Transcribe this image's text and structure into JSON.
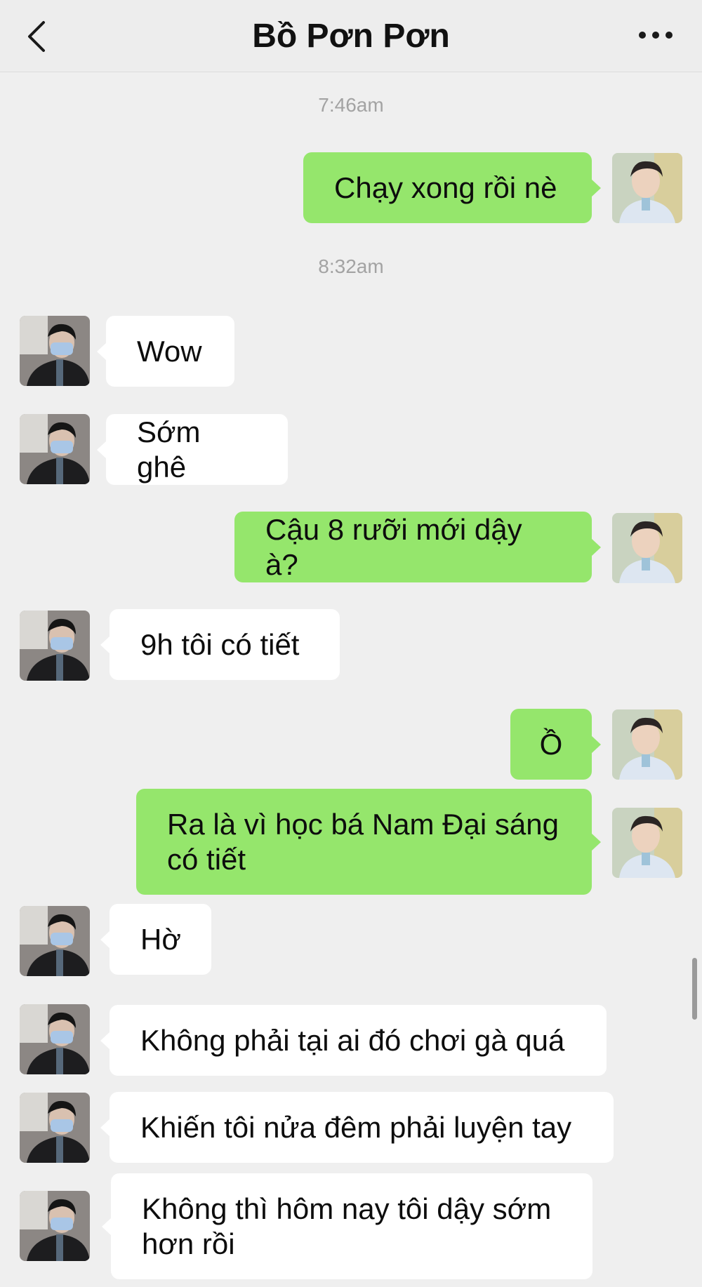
{
  "header": {
    "title": "Bồ Pơn Pơn"
  },
  "timestamps": [
    "7:46am",
    "8:32am"
  ],
  "messages": [
    {
      "side": "right",
      "text": "Chạy xong rồi nè"
    },
    {
      "side": "left",
      "text": "Wow"
    },
    {
      "side": "left",
      "text": "Sớm ghê"
    },
    {
      "side": "right",
      "text": "Cậu 8 rưỡi mới dậy à?"
    },
    {
      "side": "left",
      "text": "9h tôi có tiết"
    },
    {
      "side": "right",
      "text": "Ồ"
    },
    {
      "side": "right",
      "text": "Ra là vì học bá Nam Đại sáng có tiết"
    },
    {
      "side": "left",
      "text": "Hờ"
    },
    {
      "side": "left",
      "text": "Không phải tại ai đó chơi gà quá"
    },
    {
      "side": "left",
      "text": "Khiến tôi nửa đêm phải luyện tay"
    },
    {
      "side": "left",
      "text": "Không thì hôm nay tôi dậy sớm hơn rồi"
    }
  ],
  "icons": {
    "back": "chevron-left-icon",
    "more": "more-dots-icon"
  },
  "colors": {
    "sent_bubble": "#95e66c",
    "received_bubble": "#ffffff",
    "background": "#efefef"
  }
}
